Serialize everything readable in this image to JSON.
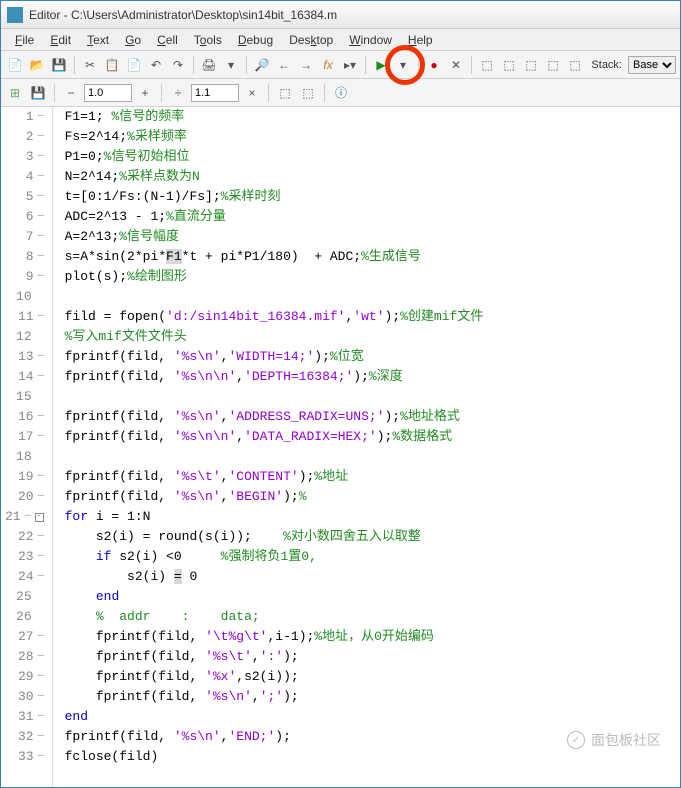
{
  "title": "Editor - C:\\Users\\Administrator\\Desktop\\sin14bit_16384.m",
  "menu": {
    "file": "File",
    "edit": "Edit",
    "text": "Text",
    "go": "Go",
    "cell": "Cell",
    "tools": "Tools",
    "debug": "Debug",
    "desktop": "Desktop",
    "window": "Window",
    "help": "Help"
  },
  "toolbar": {
    "stack_label": "Stack:",
    "stack_value": "Base",
    "field1": "1.0",
    "field2": "1.1"
  },
  "code": [
    {
      "n": 1,
      "d": true,
      "seg": [
        [
          "n",
          "F1=1; "
        ],
        [
          "c",
          "%信号的频率"
        ]
      ]
    },
    {
      "n": 2,
      "d": true,
      "seg": [
        [
          "n",
          "Fs=2^14;"
        ],
        [
          "c",
          "%采样频率"
        ]
      ]
    },
    {
      "n": 3,
      "d": true,
      "seg": [
        [
          "n",
          "P1=0;"
        ],
        [
          "c",
          "%信号初始相位"
        ]
      ]
    },
    {
      "n": 4,
      "d": true,
      "seg": [
        [
          "n",
          "N=2^14;"
        ],
        [
          "c",
          "%采样点数为N"
        ]
      ]
    },
    {
      "n": 5,
      "d": true,
      "seg": [
        [
          "n",
          "t=[0:1/Fs:(N-1)/Fs];"
        ],
        [
          "c",
          "%采样时刻"
        ]
      ]
    },
    {
      "n": 6,
      "d": true,
      "seg": [
        [
          "n",
          "ADC=2^13 - 1;"
        ],
        [
          "c",
          "%直流分量"
        ]
      ]
    },
    {
      "n": 7,
      "d": true,
      "seg": [
        [
          "n",
          "A=2^13;"
        ],
        [
          "c",
          "%信号幅度"
        ]
      ]
    },
    {
      "n": 8,
      "d": true,
      "seg": [
        [
          "n",
          "s=A*sin(2*pi*"
        ],
        [
          "hl",
          "F1"
        ],
        [
          "n",
          "*t + pi*P1/180)  + ADC;"
        ],
        [
          "c",
          "%生成信号"
        ]
      ]
    },
    {
      "n": 9,
      "d": true,
      "seg": [
        [
          "n",
          "plot(s);"
        ],
        [
          "c",
          "%绘制图形"
        ]
      ]
    },
    {
      "n": 10,
      "seg": []
    },
    {
      "n": 11,
      "d": true,
      "seg": [
        [
          "n",
          "fild = fopen("
        ],
        [
          "s",
          "'d:/sin14bit_16384.mif'"
        ],
        [
          "n",
          ","
        ],
        [
          "s",
          "'wt'"
        ],
        [
          "n",
          ");"
        ],
        [
          "c",
          "%创建mif文件"
        ]
      ]
    },
    {
      "n": 12,
      "seg": [
        [
          "c",
          "%写入mif文件文件头"
        ]
      ]
    },
    {
      "n": 13,
      "d": true,
      "seg": [
        [
          "n",
          "fprintf(fild, "
        ],
        [
          "s",
          "'%s\\n'"
        ],
        [
          "n",
          ","
        ],
        [
          "s",
          "'WIDTH=14;'"
        ],
        [
          "n",
          ");"
        ],
        [
          "c",
          "%位宽"
        ]
      ]
    },
    {
      "n": 14,
      "d": true,
      "seg": [
        [
          "n",
          "fprintf(fild, "
        ],
        [
          "s",
          "'%s\\n\\n'"
        ],
        [
          "n",
          ","
        ],
        [
          "s",
          "'DEPTH=16384;'"
        ],
        [
          "n",
          ");"
        ],
        [
          "c",
          "%深度"
        ]
      ]
    },
    {
      "n": 15,
      "seg": []
    },
    {
      "n": 16,
      "d": true,
      "seg": [
        [
          "n",
          "fprintf(fild, "
        ],
        [
          "s",
          "'%s\\n'"
        ],
        [
          "n",
          ","
        ],
        [
          "s",
          "'ADDRESS_RADIX=UNS;'"
        ],
        [
          "n",
          ");"
        ],
        [
          "c",
          "%地址格式"
        ]
      ]
    },
    {
      "n": 17,
      "d": true,
      "seg": [
        [
          "n",
          "fprintf(fild, "
        ],
        [
          "s",
          "'%s\\n\\n'"
        ],
        [
          "n",
          ","
        ],
        [
          "s",
          "'DATA_RADIX=HEX;'"
        ],
        [
          "n",
          ");"
        ],
        [
          "c",
          "%数据格式"
        ]
      ]
    },
    {
      "n": 18,
      "seg": []
    },
    {
      "n": 19,
      "d": true,
      "seg": [
        [
          "n",
          "fprintf(fild, "
        ],
        [
          "s",
          "'%s\\t'"
        ],
        [
          "n",
          ","
        ],
        [
          "s",
          "'CONTENT'"
        ],
        [
          "n",
          ");"
        ],
        [
          "c",
          "%地址"
        ]
      ]
    },
    {
      "n": 20,
      "d": true,
      "seg": [
        [
          "n",
          "fprintf(fild, "
        ],
        [
          "s",
          "'%s\\n'"
        ],
        [
          "n",
          ","
        ],
        [
          "s",
          "'BEGIN'"
        ],
        [
          "n",
          ");"
        ],
        [
          "c",
          "%"
        ]
      ]
    },
    {
      "n": 21,
      "d": true,
      "fold": "-",
      "seg": [
        [
          "k",
          "for"
        ],
        [
          "n",
          " i = 1:N"
        ]
      ]
    },
    {
      "n": 22,
      "d": true,
      "seg": [
        [
          "n",
          "    s2(i) = round(s(i));    "
        ],
        [
          "c",
          "%对小数四舍五入以取整"
        ]
      ]
    },
    {
      "n": 23,
      "d": true,
      "seg": [
        [
          "n",
          "    "
        ],
        [
          "k",
          "if"
        ],
        [
          "n",
          " s2(i) <0     "
        ],
        [
          "c",
          "%强制将负1置0,"
        ]
      ]
    },
    {
      "n": 24,
      "d": true,
      "seg": [
        [
          "n",
          "        s2(i) "
        ],
        [
          "hl",
          "="
        ],
        [
          "n",
          " 0"
        ]
      ]
    },
    {
      "n": 25,
      "seg": [
        [
          "n",
          "    "
        ],
        [
          "k",
          "end"
        ]
      ]
    },
    {
      "n": 26,
      "seg": [
        [
          "n",
          "    "
        ],
        [
          "c",
          "%  addr    :    data;"
        ]
      ]
    },
    {
      "n": 27,
      "d": true,
      "seg": [
        [
          "n",
          "    fprintf(fild, "
        ],
        [
          "s",
          "'\\t%g\\t'"
        ],
        [
          "n",
          ",i-1);"
        ],
        [
          "c",
          "%地址，从0开始编码"
        ]
      ]
    },
    {
      "n": 28,
      "d": true,
      "seg": [
        [
          "n",
          "    fprintf(fild, "
        ],
        [
          "s",
          "'%s\\t'"
        ],
        [
          "n",
          ","
        ],
        [
          "s",
          "':'"
        ],
        [
          "n",
          ");"
        ]
      ]
    },
    {
      "n": 29,
      "d": true,
      "seg": [
        [
          "n",
          "    fprintf(fild, "
        ],
        [
          "s",
          "'%x'"
        ],
        [
          "n",
          ",s2(i));"
        ]
      ]
    },
    {
      "n": 30,
      "d": true,
      "seg": [
        [
          "n",
          "    fprintf(fild, "
        ],
        [
          "s",
          "'%s\\n'"
        ],
        [
          "n",
          ","
        ],
        [
          "s",
          "';'"
        ],
        [
          "n",
          ");"
        ]
      ]
    },
    {
      "n": 31,
      "d": true,
      "seg": [
        [
          "k",
          "end"
        ]
      ]
    },
    {
      "n": 32,
      "d": true,
      "seg": [
        [
          "n",
          "fprintf(fild, "
        ],
        [
          "s",
          "'%s\\n'"
        ],
        [
          "n",
          ","
        ],
        [
          "s",
          "'END;'"
        ],
        [
          "n",
          ");"
        ]
      ]
    },
    {
      "n": 33,
      "d": true,
      "seg": [
        [
          "n",
          "fclose(fild)"
        ]
      ]
    }
  ],
  "watermark": "面包板社区"
}
